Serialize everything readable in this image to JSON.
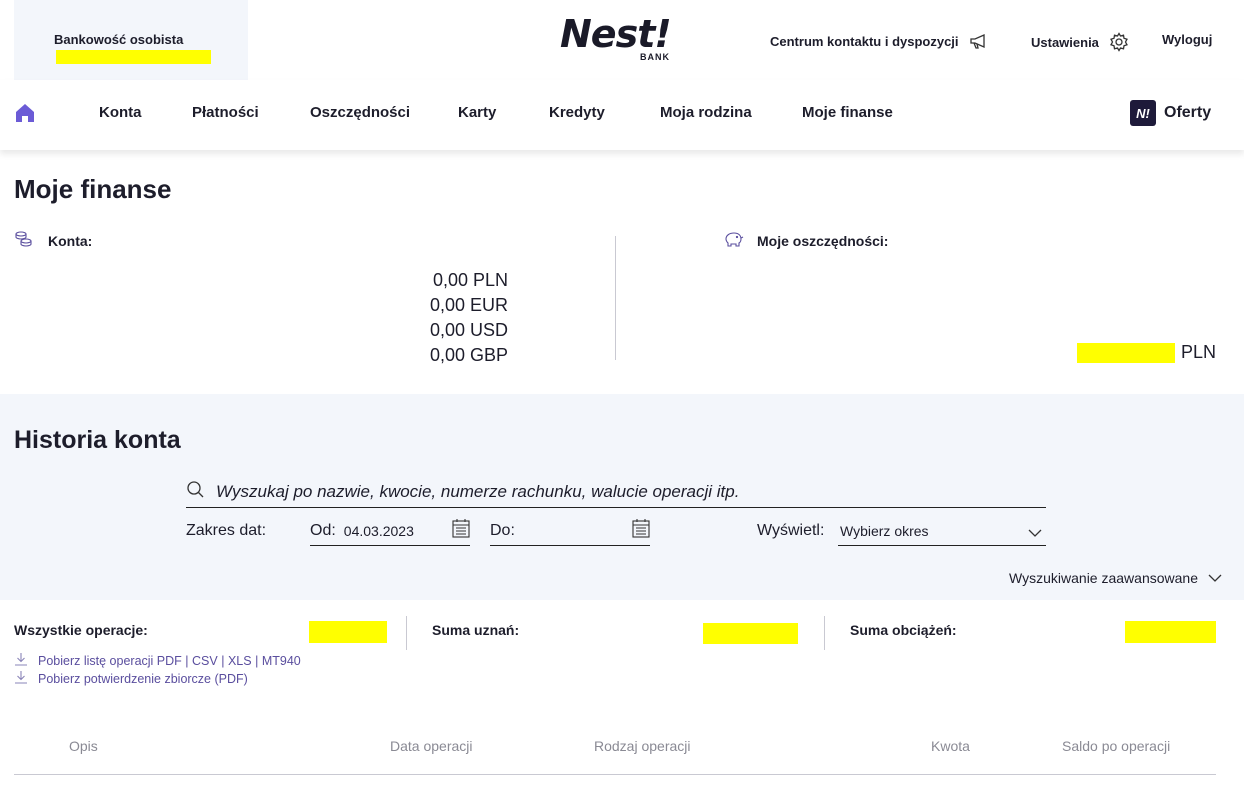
{
  "header": {
    "account_label": "Bankowość osobista",
    "logo_text": "Nest!",
    "logo_sub": "BANK",
    "contact_label": "Centrum kontaktu i dyspozycji",
    "settings_label": "Ustawienia",
    "logout_label": "Wyloguj"
  },
  "nav": {
    "items": [
      "Konta",
      "Płatności",
      "Oszczędności",
      "Karty",
      "Kredyty",
      "Moja rodzina",
      "Moje finanse"
    ],
    "offers_badge": "N!",
    "offers_label": "Oferty"
  },
  "finanse": {
    "title": "Moje finanse",
    "accounts_label": "Konta:",
    "balances": [
      "0,00 PLN",
      "0,00 EUR",
      "0,00 USD",
      "0,00 GBP"
    ],
    "savings_label": "Moje oszczędności:",
    "savings_currency": "PLN"
  },
  "history": {
    "title": "Historia konta",
    "search_placeholder": "Wyszukaj po nazwie, kwocie, numerze rachunku, walucie operacji itp.",
    "date_range_label": "Zakres dat:",
    "from_label": "Od:",
    "from_value": "04.03.2023",
    "to_label": "Do:",
    "to_value": "",
    "display_label": "Wyświetl:",
    "display_value": "Wybierz okres",
    "advanced_search": "Wyszukiwanie zaawansowane"
  },
  "summary": {
    "all_ops_label": "Wszystkie operacje:",
    "credits_label": "Suma uznań:",
    "debits_label": "Suma obciążeń:",
    "download_list_label": "Pobierz listę operacji PDF",
    "download_formats": [
      "CSV",
      "XLS",
      "MT940"
    ],
    "download_confirmation": "Pobierz potwierdzenie zbiorcze (PDF)"
  },
  "table": {
    "headers": [
      "Opis",
      "Data operacji",
      "Rodzaj operacji",
      "Kwota",
      "Saldo po operacji"
    ]
  },
  "colors": {
    "accent_purple": "#6b5bd6",
    "link_purple": "#5a4e9e",
    "panel_bg": "#f3f6fb",
    "redaction": "#ffff00"
  }
}
